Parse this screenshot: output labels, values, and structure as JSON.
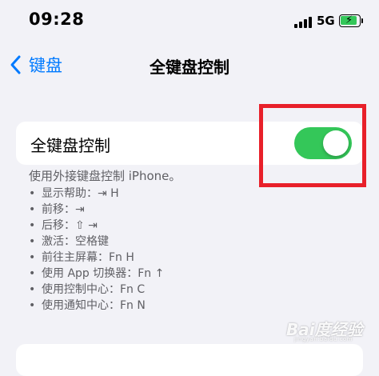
{
  "status_bar": {
    "time": "09:28",
    "network": "5G",
    "battery_charging": true,
    "battery_color": "#34c759"
  },
  "nav": {
    "back_label": "键盘",
    "title": "全键盘控制",
    "accent_color": "#007aff"
  },
  "setting": {
    "label": "全键盘控制",
    "toggle_on": true,
    "toggle_color": "#34c759"
  },
  "footer": {
    "description": "使用外接键盘控制 iPhone。",
    "items": [
      "显示帮助：⇥ H",
      "前移：⇥",
      "后移：⇧ ⇥",
      "激活：空格键",
      "前往主屏幕：Fn H",
      "使用 App 切换器：Fn ↑",
      "使用控制中心：Fn C",
      "使用通知中心：Fn N"
    ]
  },
  "annotation": {
    "highlight_color": "#e8202a"
  },
  "watermark": {
    "main": "Bai度经验",
    "sub": "jingyan.baidu.com"
  }
}
